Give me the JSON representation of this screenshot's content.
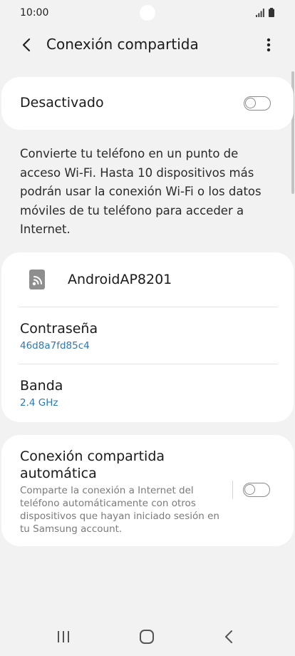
{
  "status_bar": {
    "time": "10:00"
  },
  "header": {
    "title": "Conexión compartida"
  },
  "master": {
    "label": "Desactivado",
    "enabled": false
  },
  "description": "Convierte tu teléfono en un punto de acceso Wi-Fi. Hasta 10 dispositivos más podrán usar la conexión Wi-Fi o los datos móviles de tu teléfono para acceder a Internet.",
  "network": {
    "name": "AndroidAP8201",
    "password_label": "Contraseña",
    "password_value": "46d8a7fd85c4",
    "band_label": "Banda",
    "band_value": "2.4 GHz"
  },
  "auto_hotspot": {
    "title": "Conexión compartida automática",
    "description": "Comparte la conexión a Internet del teléfono automáticamente con otros dispositivos que hayan iniciado sesión en tu Samsung account.",
    "enabled": false
  },
  "icons": {
    "back": "chevron-left-icon",
    "more": "more-vert-icon",
    "network": "phone-hotspot-icon",
    "signal": "signal-icon",
    "battery": "battery-icon"
  },
  "colors": {
    "background": "#f2f2f2",
    "card": "#ffffff",
    "accent_value": "#2c78b8",
    "toggle_off": "#8a8a8a"
  }
}
